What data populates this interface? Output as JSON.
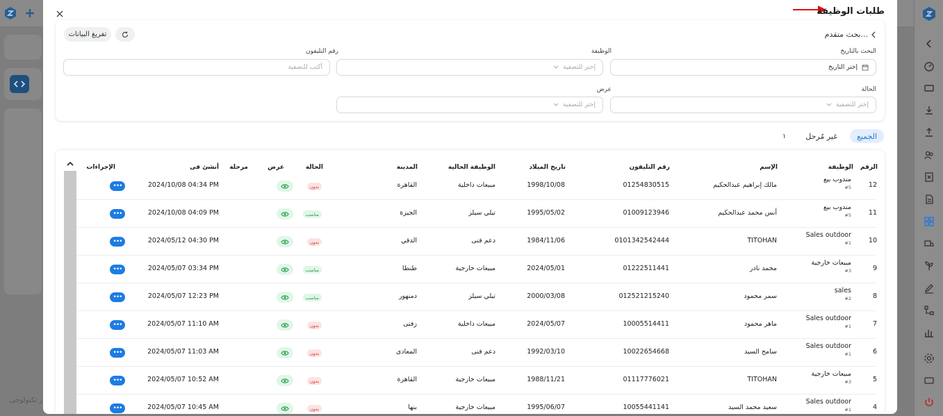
{
  "modal": {
    "title": "طلبات الوظيفة",
    "advanced_search": "بحث متقدم...",
    "export_label": "تفريغ البيانات"
  },
  "filters": {
    "date_label": "البحث بالتاريخ",
    "date_placeholder": "إختر التاريخ",
    "job_label": "الوظيفة",
    "job_placeholder": "إختر للتصفية",
    "phone_label": "رقم التليفون",
    "phone_placeholder": "أكتب للتصفية",
    "status_label": "الحالة",
    "status_placeholder": "إختر للتصفية",
    "view_label": "عرض",
    "view_placeholder": "إختر للتصفية"
  },
  "tabs": [
    {
      "label": "الجميع",
      "active": true
    },
    {
      "label": "غير مُرحل",
      "active": false
    }
  ],
  "tab_count": "١",
  "table": {
    "headers": {
      "number": "الرقم",
      "job": "الوظيفة",
      "name": "الإسم",
      "phone": "رقم التليفون",
      "birth": "تاريخ الميلاد",
      "current_job": "الوظيفة الحالية",
      "city": "المدينة",
      "status": "الحالة",
      "view": "عرض",
      "stage": "مرحلة",
      "created": "أنشئ فى",
      "actions": "الإجراءات"
    },
    "rows": [
      {
        "num": "12",
        "job": "مندوب بيع",
        "job_code": "#5",
        "name": "مالك إبراهيم عبدالحكيم",
        "phone": "01254830515",
        "birth": "1998/10/08",
        "current_job": "مبيعات داخلية",
        "city": "القاهرة",
        "status": "بدون",
        "status_color": "red",
        "created": "2024/10/08 04:34 PM"
      },
      {
        "num": "11",
        "job": "مندوب بيع",
        "job_code": "#5",
        "name": "أنس محمد عبدالحكيم",
        "phone": "01009123946",
        "birth": "1995/05/02",
        "current_job": "تيلي سيلز",
        "city": "الجيزة",
        "status": "مناسب",
        "status_color": "green",
        "created": "2024/10/08 04:09 PM"
      },
      {
        "num": "10",
        "job": "Sales outdoor",
        "job_code": "#1",
        "name": "TITOHAN",
        "phone": "0101342542444",
        "birth": "1984/11/06",
        "current_job": "دعم فنى",
        "city": "الدقي",
        "status": "بدون",
        "status_color": "red",
        "created": "2024/05/12 04:30 PM"
      },
      {
        "num": "9",
        "job": "مبيعات خارجية",
        "job_code": "#3",
        "name": "محمد نادر",
        "phone": "01222511441",
        "birth": "2024/05/01",
        "current_job": "مبيعات خارجية",
        "city": "طنطا",
        "status": "مناسب",
        "status_color": "green",
        "created": "2024/05/07 03:34 PM"
      },
      {
        "num": "8",
        "job": "sales",
        "job_code": "#2",
        "name": "سمر محمود",
        "phone": "012521215240",
        "birth": "2000/03/08",
        "current_job": "تيلي سيلز",
        "city": "دمنهور",
        "status": "مناسب",
        "status_color": "green",
        "created": "2024/05/07 12:23 PM"
      },
      {
        "num": "7",
        "job": "Sales outdoor",
        "job_code": "#1",
        "name": "ماهر محمود",
        "phone": "10005514411",
        "birth": "2024/05/07",
        "current_job": "مبيعات داخلية",
        "city": "زفتى",
        "status": "بدون",
        "status_color": "red",
        "created": "2024/05/07 11:10 AM"
      },
      {
        "num": "6",
        "job": "Sales outdoor",
        "job_code": "#1",
        "name": "سامح السيد",
        "phone": "10022654668",
        "birth": "1992/03/10",
        "current_job": "دعم فنى",
        "city": "المعادى",
        "status": "بدون",
        "status_color": "red",
        "created": "2024/05/07 11:03 AM"
      },
      {
        "num": "5",
        "job": "مبيعات خارجية",
        "job_code": "#3",
        "name": "TITOHAN",
        "phone": "01117776021",
        "birth": "1988/11/21",
        "current_job": "مبيعات خارجية",
        "city": "القاهرة",
        "status": "بدون",
        "status_color": "red",
        "created": "2024/05/07 10:52 AM"
      },
      {
        "num": "4",
        "job": "Sales outdoor",
        "job_code": "#1",
        "name": "سعيد محمد السيد",
        "phone": "10055441141",
        "birth": "1995/06/07",
        "current_job": "مبيعات خارجية",
        "city": "بنها",
        "status": "بدون",
        "status_color": "red",
        "created": "2024/05/07 10:45 AM"
      }
    ]
  },
  "background": {
    "footer_text": "ر تكنولوجى"
  },
  "colors": {
    "accent": "#1d7ce2",
    "brand": "#2a78d8",
    "badge_red": "#d33333",
    "badge_green": "#2aa14f"
  }
}
